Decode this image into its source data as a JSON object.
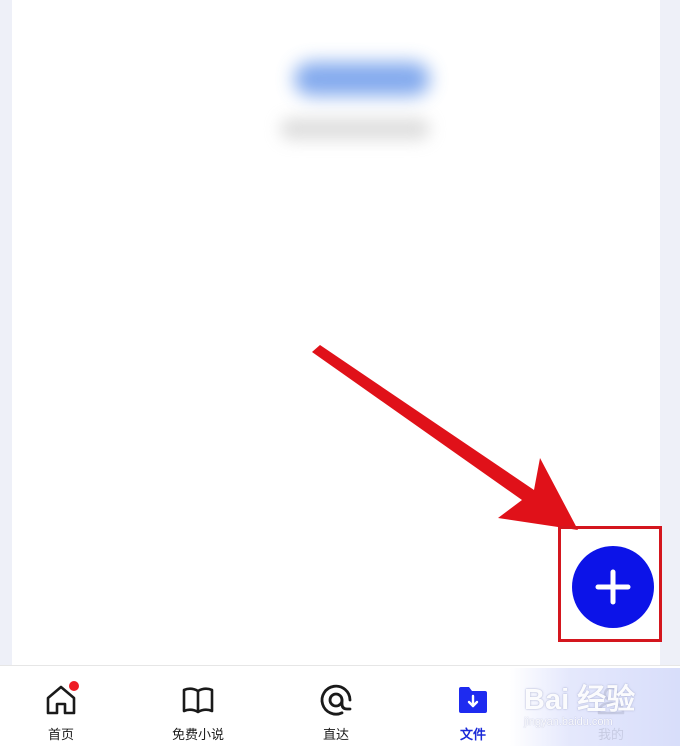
{
  "colors": {
    "fab": "#0c13e8",
    "annotation": "#d4161e",
    "active_tab": "#1a2ad8",
    "badge": "#ee1c25"
  },
  "content": {
    "blurred_title": "",
    "blurred_subtitle": ""
  },
  "fab": {
    "icon": "plus-icon"
  },
  "annotation": {
    "type": "red-arrow-pointing-to-fab",
    "highlight": "red-rectangle"
  },
  "bottom_nav": {
    "items": [
      {
        "label": "首页",
        "icon": "home-icon",
        "badge": true,
        "active": false
      },
      {
        "label": "免费小说",
        "icon": "book-icon",
        "badge": false,
        "active": false
      },
      {
        "label": "直达",
        "icon": "direct-icon",
        "badge": false,
        "active": false
      },
      {
        "label": "文件",
        "icon": "file-download-icon",
        "badge": false,
        "active": true
      },
      {
        "label": "我的",
        "icon": "user-icon",
        "badge": false,
        "active": false
      }
    ]
  },
  "watermark": {
    "logo": "Bai  经验",
    "url": "jingyan.baidu.com"
  }
}
